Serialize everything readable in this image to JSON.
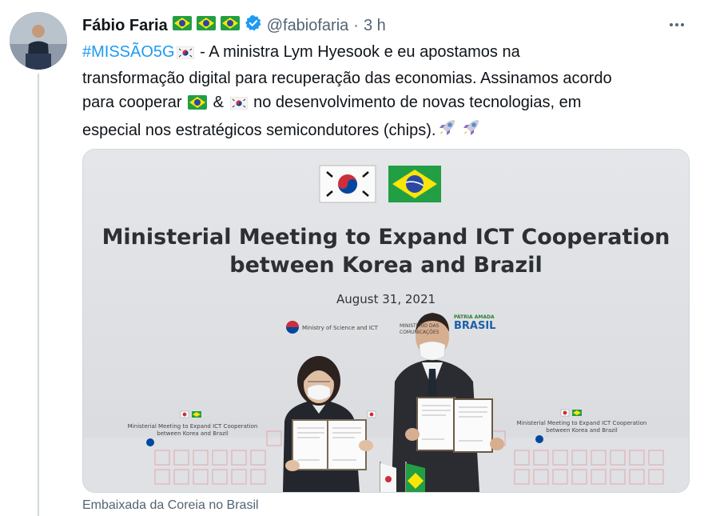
{
  "tweet": {
    "author_name": "Fábio Faria",
    "author_handle": "@fabiofaria",
    "separator": "·",
    "time": "3 h",
    "text": {
      "hashtag": "#MISSÃO5G",
      "line1_rest": "- A ministra Lym Hyesook e eu apostamos na",
      "line2": "transformação digital para recuperação das economias. Assinamos acordo",
      "line3_a": "para cooperar",
      "line3_b": "&",
      "line3_c": "no desenvolvimento de novas tecnologias, em",
      "line4": "especial nos estratégicos semicondutores (chips)."
    },
    "caption": "Embaixada da Coreia no Brasil"
  },
  "media": {
    "title_line1": "Ministerial Meeting to Expand ICT Cooperation",
    "title_line2": "between Korea and Brazil",
    "date": "August 31, 2021",
    "ministry_label": "Ministry of Science and ICT",
    "comms_label": "MINISTÉRIO DAS COMUNICAÇÕES",
    "patria_label": "PÁTRIA AMADA",
    "brasil_label": "BRASIL",
    "small_title_line1": "Ministerial Meeting to Expand ICT Cooperation",
    "small_title_line2": "between Korea and Brazil"
  },
  "colors": {
    "link": "#1d9bf0",
    "verified": "#1d9bf0",
    "secondary_text": "#536471",
    "border": "#cfd9de"
  },
  "icons": [
    "brazil-flag-icon",
    "verified-badge-icon",
    "more-options-icon",
    "korea-flag-icon",
    "rocket-icon"
  ]
}
